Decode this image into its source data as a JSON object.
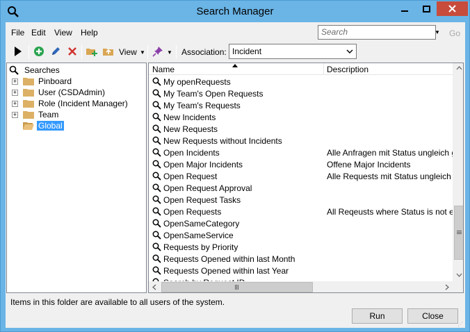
{
  "window": {
    "title": "Search Manager",
    "colors": {
      "titlebar": "#6ab4e6",
      "close_button": "#c74c3c",
      "selection": "#3399ff"
    }
  },
  "menu": [
    "File",
    "Edit",
    "View",
    "Help"
  ],
  "search": {
    "placeholder": "Search",
    "go_label": "Go"
  },
  "toolbar": {
    "icons": [
      "run-icon",
      "add-icon",
      "edit-icon",
      "delete-icon",
      "new-folder-icon",
      "folder-up-icon",
      "pin-icon"
    ],
    "view_label": "View",
    "association_label": "Association:",
    "association_value": "Incident"
  },
  "tree": {
    "root": "Searches",
    "items": [
      {
        "label": "Pinboard",
        "expandable": true,
        "selected": false
      },
      {
        "label": "User (CSDAdmin)",
        "expandable": true,
        "selected": false
      },
      {
        "label": "Role (Incident Manager)",
        "expandable": true,
        "selected": false
      },
      {
        "label": "Team",
        "expandable": true,
        "selected": false
      },
      {
        "label": "Global",
        "expandable": false,
        "selected": true
      }
    ]
  },
  "list": {
    "columns": {
      "name": "Name",
      "description": "Description"
    },
    "rows": [
      {
        "name": "My openRequests",
        "description": ""
      },
      {
        "name": "My Team's  Open Requests",
        "description": ""
      },
      {
        "name": "My Team's Requests",
        "description": ""
      },
      {
        "name": "New Incidents",
        "description": ""
      },
      {
        "name": "New Requests",
        "description": ""
      },
      {
        "name": "New Requests without Incidents",
        "description": ""
      },
      {
        "name": "Open Incidents",
        "description": "Alle Anfragen mit Status ungleich gesc"
      },
      {
        "name": "Open Major Incidents",
        "description": "Offene Major Incidents"
      },
      {
        "name": "Open Request",
        "description": "Alle Requests mit Status ungleich gesc"
      },
      {
        "name": "Open Request Approval",
        "description": ""
      },
      {
        "name": "Open Request Tasks",
        "description": ""
      },
      {
        "name": "Open Requests",
        "description": "All Reqeusts where Status is not equal"
      },
      {
        "name": "OpenSameCategory",
        "description": ""
      },
      {
        "name": "OpenSameService",
        "description": ""
      },
      {
        "name": "Requests by Priority",
        "description": ""
      },
      {
        "name": "Requests Opened within last Month",
        "description": ""
      },
      {
        "name": "Requests Opened within last Year",
        "description": ""
      },
      {
        "name": "Search by Request ID",
        "description": ""
      }
    ]
  },
  "status": "Items in this folder are available to all users of the system.",
  "buttons": {
    "run": "Run",
    "close": "Close"
  }
}
